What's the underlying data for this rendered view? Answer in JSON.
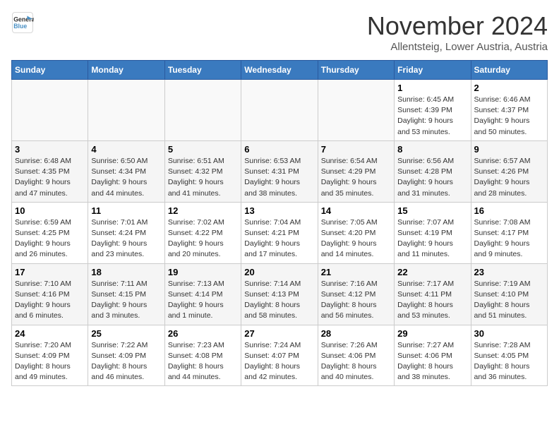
{
  "logo": {
    "line1": "General",
    "line2": "Blue"
  },
  "header": {
    "month": "November 2024",
    "location": "Allentsteig, Lower Austria, Austria"
  },
  "weekdays": [
    "Sunday",
    "Monday",
    "Tuesday",
    "Wednesday",
    "Thursday",
    "Friday",
    "Saturday"
  ],
  "weeks": [
    [
      {
        "day": "",
        "info": ""
      },
      {
        "day": "",
        "info": ""
      },
      {
        "day": "",
        "info": ""
      },
      {
        "day": "",
        "info": ""
      },
      {
        "day": "",
        "info": ""
      },
      {
        "day": "1",
        "info": "Sunrise: 6:45 AM\nSunset: 4:39 PM\nDaylight: 9 hours\nand 53 minutes."
      },
      {
        "day": "2",
        "info": "Sunrise: 6:46 AM\nSunset: 4:37 PM\nDaylight: 9 hours\nand 50 minutes."
      }
    ],
    [
      {
        "day": "3",
        "info": "Sunrise: 6:48 AM\nSunset: 4:35 PM\nDaylight: 9 hours\nand 47 minutes."
      },
      {
        "day": "4",
        "info": "Sunrise: 6:50 AM\nSunset: 4:34 PM\nDaylight: 9 hours\nand 44 minutes."
      },
      {
        "day": "5",
        "info": "Sunrise: 6:51 AM\nSunset: 4:32 PM\nDaylight: 9 hours\nand 41 minutes."
      },
      {
        "day": "6",
        "info": "Sunrise: 6:53 AM\nSunset: 4:31 PM\nDaylight: 9 hours\nand 38 minutes."
      },
      {
        "day": "7",
        "info": "Sunrise: 6:54 AM\nSunset: 4:29 PM\nDaylight: 9 hours\nand 35 minutes."
      },
      {
        "day": "8",
        "info": "Sunrise: 6:56 AM\nSunset: 4:28 PM\nDaylight: 9 hours\nand 31 minutes."
      },
      {
        "day": "9",
        "info": "Sunrise: 6:57 AM\nSunset: 4:26 PM\nDaylight: 9 hours\nand 28 minutes."
      }
    ],
    [
      {
        "day": "10",
        "info": "Sunrise: 6:59 AM\nSunset: 4:25 PM\nDaylight: 9 hours\nand 26 minutes."
      },
      {
        "day": "11",
        "info": "Sunrise: 7:01 AM\nSunset: 4:24 PM\nDaylight: 9 hours\nand 23 minutes."
      },
      {
        "day": "12",
        "info": "Sunrise: 7:02 AM\nSunset: 4:22 PM\nDaylight: 9 hours\nand 20 minutes."
      },
      {
        "day": "13",
        "info": "Sunrise: 7:04 AM\nSunset: 4:21 PM\nDaylight: 9 hours\nand 17 minutes."
      },
      {
        "day": "14",
        "info": "Sunrise: 7:05 AM\nSunset: 4:20 PM\nDaylight: 9 hours\nand 14 minutes."
      },
      {
        "day": "15",
        "info": "Sunrise: 7:07 AM\nSunset: 4:19 PM\nDaylight: 9 hours\nand 11 minutes."
      },
      {
        "day": "16",
        "info": "Sunrise: 7:08 AM\nSunset: 4:17 PM\nDaylight: 9 hours\nand 9 minutes."
      }
    ],
    [
      {
        "day": "17",
        "info": "Sunrise: 7:10 AM\nSunset: 4:16 PM\nDaylight: 9 hours\nand 6 minutes."
      },
      {
        "day": "18",
        "info": "Sunrise: 7:11 AM\nSunset: 4:15 PM\nDaylight: 9 hours\nand 3 minutes."
      },
      {
        "day": "19",
        "info": "Sunrise: 7:13 AM\nSunset: 4:14 PM\nDaylight: 9 hours\nand 1 minute."
      },
      {
        "day": "20",
        "info": "Sunrise: 7:14 AM\nSunset: 4:13 PM\nDaylight: 8 hours\nand 58 minutes."
      },
      {
        "day": "21",
        "info": "Sunrise: 7:16 AM\nSunset: 4:12 PM\nDaylight: 8 hours\nand 56 minutes."
      },
      {
        "day": "22",
        "info": "Sunrise: 7:17 AM\nSunset: 4:11 PM\nDaylight: 8 hours\nand 53 minutes."
      },
      {
        "day": "23",
        "info": "Sunrise: 7:19 AM\nSunset: 4:10 PM\nDaylight: 8 hours\nand 51 minutes."
      }
    ],
    [
      {
        "day": "24",
        "info": "Sunrise: 7:20 AM\nSunset: 4:09 PM\nDaylight: 8 hours\nand 49 minutes."
      },
      {
        "day": "25",
        "info": "Sunrise: 7:22 AM\nSunset: 4:09 PM\nDaylight: 8 hours\nand 46 minutes."
      },
      {
        "day": "26",
        "info": "Sunrise: 7:23 AM\nSunset: 4:08 PM\nDaylight: 8 hours\nand 44 minutes."
      },
      {
        "day": "27",
        "info": "Sunrise: 7:24 AM\nSunset: 4:07 PM\nDaylight: 8 hours\nand 42 minutes."
      },
      {
        "day": "28",
        "info": "Sunrise: 7:26 AM\nSunset: 4:06 PM\nDaylight: 8 hours\nand 40 minutes."
      },
      {
        "day": "29",
        "info": "Sunrise: 7:27 AM\nSunset: 4:06 PM\nDaylight: 8 hours\nand 38 minutes."
      },
      {
        "day": "30",
        "info": "Sunrise: 7:28 AM\nSunset: 4:05 PM\nDaylight: 8 hours\nand 36 minutes."
      }
    ]
  ]
}
